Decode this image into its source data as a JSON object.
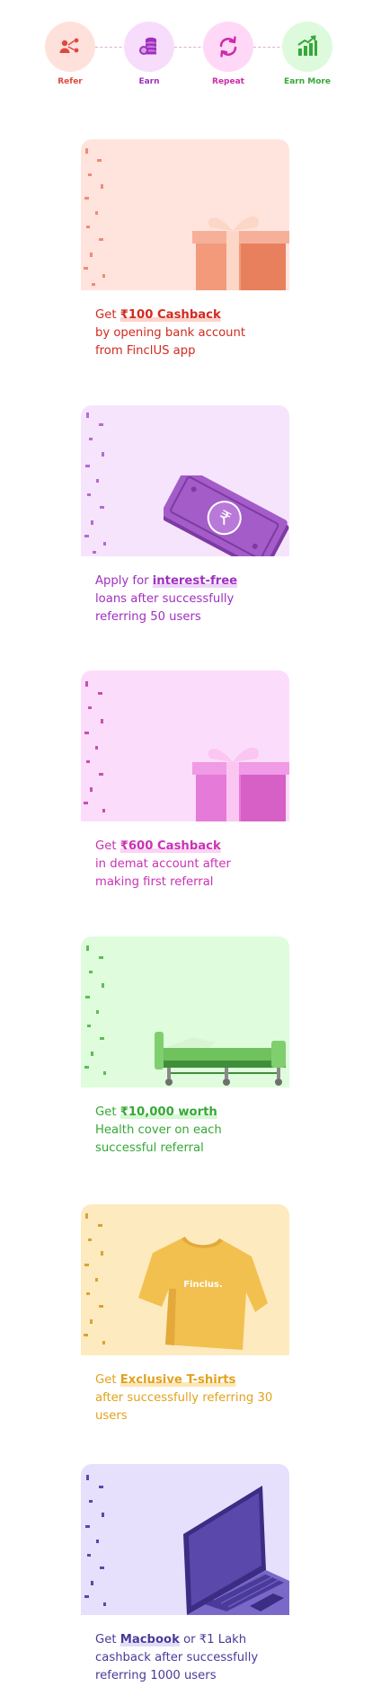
{
  "steps": [
    {
      "label": "Refer",
      "icon": "refer-icon",
      "color": "#e0483d",
      "bg": "#ffe1dc"
    },
    {
      "label": "Earn",
      "icon": "coins-icon",
      "color": "#a02fc1",
      "bg": "#f7dcfb"
    },
    {
      "label": "Repeat",
      "icon": "repeat-icon",
      "color": "#cf2aa8",
      "bg": "#ffd8f7"
    },
    {
      "label": "Earn More",
      "icon": "growth-chart-icon",
      "color": "#35a837",
      "bg": "#ddfbdc"
    }
  ],
  "rewards": [
    {
      "name": "cashback-100",
      "pre": "Get ",
      "highlight": "₹100 Cashback",
      "post": "by opening bank account from FinclUS app",
      "text_color": "#d12b1f",
      "hl_color": "#ffd3cb",
      "hero_bg": "#ffe4dd",
      "art": "gift-box"
    },
    {
      "name": "interest-free-loans",
      "pre": "Apply for ",
      "highlight": "interest-free",
      "post": "loans after successfully referring 50 users",
      "text_color": "#a02fc1",
      "hl_color": "#efd3fa",
      "hero_bg": "#f6e4fd",
      "art": "cash-note"
    },
    {
      "name": "cashback-600",
      "pre": "Get ",
      "highlight": "₹600 Cashback",
      "post": "in demat account after making first referral",
      "text_color": "#cb31b5",
      "hl_color": "#fbd3f3",
      "hero_bg": "#fcdcfb",
      "art": "gift-box"
    },
    {
      "name": "health-cover",
      "pre": "Get ",
      "highlight": "₹10,000 worth",
      "post": "Health cover on each successful referral",
      "text_color": "#35a837",
      "hl_color": "#d6f8d2",
      "hero_bg": "#dffcdc",
      "art": "hospital-bed"
    },
    {
      "name": "exclusive-tshirts",
      "pre": "Get ",
      "highlight": "Exclusive T-shirts",
      "post": "after successfully referring 30 users",
      "text_color": "#e2a21d",
      "hl_color": "#fde7b8",
      "hero_bg": "#feeabf",
      "art": "tshirt",
      "art_text": "Finclus."
    },
    {
      "name": "macbook",
      "pre": "Get ",
      "highlight": "Macbook",
      "post_inline": " or ₹1 Lakh",
      "post": "cashback after successfully referring 1000 users",
      "text_color": "#4a3a9a",
      "hl_color": "#e3ddfa",
      "hero_bg": "#e6e0fd",
      "art": "laptop"
    }
  ]
}
